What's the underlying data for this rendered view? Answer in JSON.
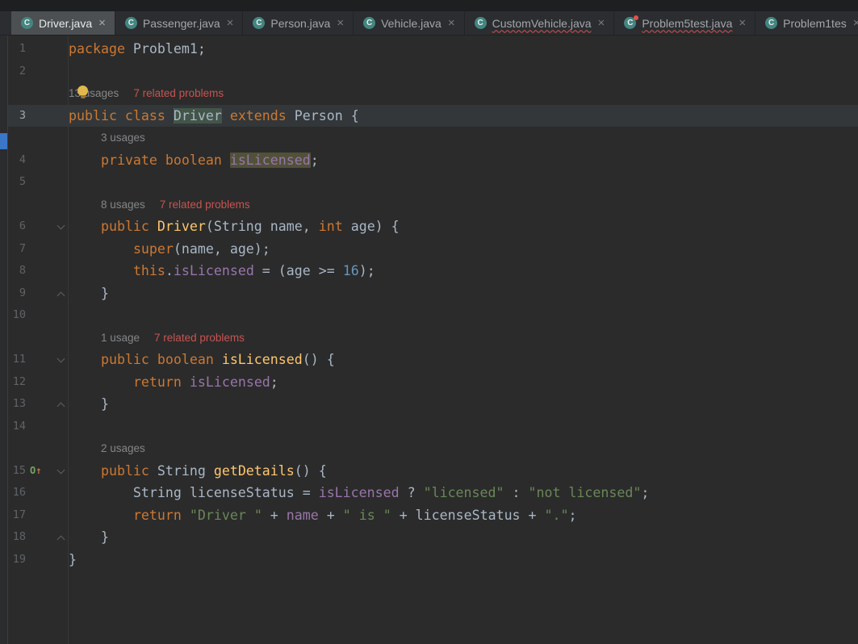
{
  "colors": {
    "editor_bg": "#2b2b2b",
    "caret_row": "#333739",
    "error_red": "#c75450",
    "marker_blue": "#3b76c8",
    "keyword_orange": "#cc7832",
    "string_green": "#6a8759",
    "field_purple": "#9876aa",
    "method_yellow": "#ffc66d",
    "number_blue": "#6897bb"
  },
  "tabbar": {
    "close_glyph": "×",
    "icon_glyph": "C",
    "tabs": [
      {
        "label": "Driver.java",
        "active": true,
        "error": false,
        "icon_badge": false
      },
      {
        "label": "Passenger.java",
        "active": false,
        "error": false,
        "icon_badge": false
      },
      {
        "label": "Person.java",
        "active": false,
        "error": false,
        "icon_badge": false
      },
      {
        "label": "Vehicle.java",
        "active": false,
        "error": false,
        "icon_badge": false
      },
      {
        "label": "CustomVehicle.java",
        "active": false,
        "error": true,
        "icon_badge": false
      },
      {
        "label": "Problem5test.java",
        "active": false,
        "error": true,
        "icon_badge": true
      },
      {
        "label": "Problem1tes",
        "active": false,
        "error": false,
        "icon_badge": false
      }
    ]
  },
  "editor": {
    "override_icon": {
      "o": "O",
      "arrow": "↑"
    },
    "lines": [
      {
        "type": "code",
        "num": 1,
        "segs": [
          {
            "t": "package",
            "c": "kw"
          },
          {
            "t": " Problem1;",
            "c": "pl"
          }
        ]
      },
      {
        "type": "code",
        "num": 2,
        "segs": []
      },
      {
        "type": "hint",
        "indent": 0,
        "bulb": true,
        "parts": [
          {
            "t": "13 usages",
            "c": "usages"
          },
          {
            "t": "7 related problems",
            "c": "problems"
          }
        ]
      },
      {
        "type": "code",
        "num": 3,
        "caret_row": true,
        "segs": [
          {
            "t": "public class ",
            "c": "kw"
          },
          {
            "t": "Driver",
            "c": "pl",
            "hl": "green",
            "caret": true
          },
          {
            "t": " ",
            "c": "pl"
          },
          {
            "t": "extends",
            "c": "kw"
          },
          {
            "t": " Person {",
            "c": "pl"
          }
        ]
      },
      {
        "type": "hint",
        "indent": 4,
        "parts": [
          {
            "t": "3 usages",
            "c": "usages"
          }
        ]
      },
      {
        "type": "code",
        "num": 4,
        "segs": [
          {
            "t": "    ",
            "c": "pl"
          },
          {
            "t": "private boolean ",
            "c": "kw"
          },
          {
            "t": "isLicensed",
            "c": "field",
            "hl": "olive"
          },
          {
            "t": ";",
            "c": "pl"
          }
        ]
      },
      {
        "type": "code",
        "num": 5,
        "segs": []
      },
      {
        "type": "hint",
        "indent": 4,
        "parts": [
          {
            "t": "8 usages",
            "c": "usages"
          },
          {
            "t": "7 related problems",
            "c": "problems"
          }
        ]
      },
      {
        "type": "code",
        "num": 6,
        "fold": "down",
        "segs": [
          {
            "t": "    ",
            "c": "pl"
          },
          {
            "t": "public ",
            "c": "kw"
          },
          {
            "t": "Driver",
            "c": "method"
          },
          {
            "t": "(String name, ",
            "c": "pl"
          },
          {
            "t": "int",
            "c": "kw"
          },
          {
            "t": " age) {",
            "c": "pl"
          }
        ]
      },
      {
        "type": "code",
        "num": 7,
        "segs": [
          {
            "t": "        ",
            "c": "pl"
          },
          {
            "t": "super",
            "c": "kw"
          },
          {
            "t": "(name, age);",
            "c": "pl"
          }
        ]
      },
      {
        "type": "code",
        "num": 8,
        "segs": [
          {
            "t": "        ",
            "c": "pl"
          },
          {
            "t": "this",
            "c": "kw"
          },
          {
            "t": ".",
            "c": "pl"
          },
          {
            "t": "isLicensed",
            "c": "field"
          },
          {
            "t": " = (age >= ",
            "c": "pl"
          },
          {
            "t": "16",
            "c": "num"
          },
          {
            "t": ");",
            "c": "pl"
          }
        ]
      },
      {
        "type": "code",
        "num": 9,
        "fold": "up",
        "segs": [
          {
            "t": "    }",
            "c": "pl"
          }
        ]
      },
      {
        "type": "code",
        "num": 10,
        "segs": []
      },
      {
        "type": "hint",
        "indent": 4,
        "parts": [
          {
            "t": "1 usage",
            "c": "usages"
          },
          {
            "t": "7 related problems",
            "c": "problems"
          }
        ]
      },
      {
        "type": "code",
        "num": 11,
        "fold": "down",
        "segs": [
          {
            "t": "    ",
            "c": "pl"
          },
          {
            "t": "public boolean ",
            "c": "kw"
          },
          {
            "t": "isLicensed",
            "c": "method"
          },
          {
            "t": "() {",
            "c": "pl"
          }
        ]
      },
      {
        "type": "code",
        "num": 12,
        "segs": [
          {
            "t": "        ",
            "c": "pl"
          },
          {
            "t": "return",
            "c": "kw"
          },
          {
            "t": " ",
            "c": "pl"
          },
          {
            "t": "isLicensed",
            "c": "field"
          },
          {
            "t": ";",
            "c": "pl"
          }
        ]
      },
      {
        "type": "code",
        "num": 13,
        "fold": "up",
        "segs": [
          {
            "t": "    }",
            "c": "pl"
          }
        ]
      },
      {
        "type": "code",
        "num": 14,
        "segs": []
      },
      {
        "type": "hint",
        "indent": 4,
        "parts": [
          {
            "t": "2 usages",
            "c": "usages"
          }
        ]
      },
      {
        "type": "code",
        "num": 15,
        "fold": "down",
        "override": true,
        "segs": [
          {
            "t": "    ",
            "c": "pl"
          },
          {
            "t": "public ",
            "c": "kw"
          },
          {
            "t": "String ",
            "c": "pl"
          },
          {
            "t": "getDetails",
            "c": "method"
          },
          {
            "t": "() {",
            "c": "pl"
          }
        ]
      },
      {
        "type": "code",
        "num": 16,
        "segs": [
          {
            "t": "        String licenseStatus = ",
            "c": "pl"
          },
          {
            "t": "isLicensed",
            "c": "field"
          },
          {
            "t": " ? ",
            "c": "pl"
          },
          {
            "t": "\"licensed\"",
            "c": "str"
          },
          {
            "t": " : ",
            "c": "pl"
          },
          {
            "t": "\"not licensed\"",
            "c": "str"
          },
          {
            "t": ";",
            "c": "pl"
          }
        ]
      },
      {
        "type": "code",
        "num": 17,
        "segs": [
          {
            "t": "        ",
            "c": "pl"
          },
          {
            "t": "return",
            "c": "kw"
          },
          {
            "t": " ",
            "c": "pl"
          },
          {
            "t": "\"Driver \"",
            "c": "str"
          },
          {
            "t": " + ",
            "c": "pl"
          },
          {
            "t": "name",
            "c": "field"
          },
          {
            "t": " + ",
            "c": "pl"
          },
          {
            "t": "\" is \"",
            "c": "str"
          },
          {
            "t": " + licenseStatus + ",
            "c": "pl"
          },
          {
            "t": "\".\"",
            "c": "str"
          },
          {
            "t": ";",
            "c": "pl"
          }
        ]
      },
      {
        "type": "code",
        "num": 18,
        "fold": "up",
        "segs": [
          {
            "t": "    }",
            "c": "pl"
          }
        ]
      },
      {
        "type": "code",
        "num": 19,
        "segs": [
          {
            "t": "}",
            "c": "pl"
          }
        ]
      }
    ]
  }
}
